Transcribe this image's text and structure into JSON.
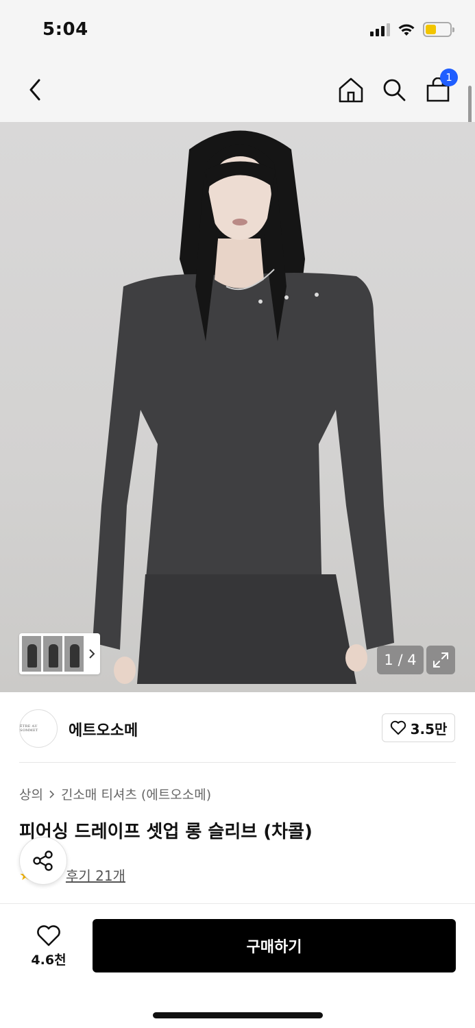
{
  "status_bar": {
    "time": "5:04",
    "battery_level": 0.3,
    "battery_color": "#f2c500"
  },
  "nav": {
    "cart_count": "1",
    "badge_color": "#1f5eff"
  },
  "gallery": {
    "page_indicator": "1 / 4"
  },
  "brand": {
    "logo_text": "ÊTRE AU SOMMET",
    "name": "에트오소메",
    "likes": "3.5만"
  },
  "breadcrumb": {
    "category": "상의",
    "subcategory": "긴소매 티셔츠 (에트오소메)"
  },
  "product": {
    "title": "피어싱 드레이프 셋업 롱 슬리브 (차콜)",
    "reviews": "후기 21개"
  },
  "bottom_bar": {
    "like_count": "4.6천",
    "buy_label": "구매하기",
    "buy_color": "#000000"
  }
}
